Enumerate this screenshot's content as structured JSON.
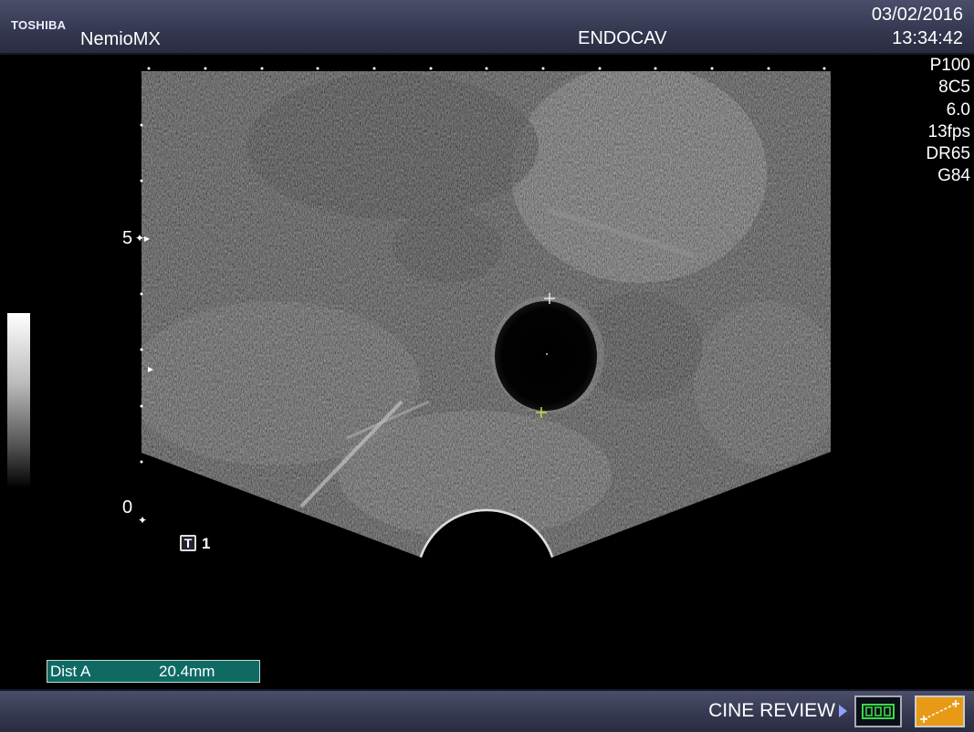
{
  "header": {
    "brand": "TOSHIBA",
    "model": "NemioMX",
    "probe": "ENDOCAV",
    "date": "03/02/2016",
    "time": "13:34:42"
  },
  "params": [
    "P100",
    "8C5",
    "6.0",
    "13fps",
    "DR65",
    "G84"
  ],
  "depth_scale": {
    "top_label": "5",
    "bottom_label": "0"
  },
  "trace_marker": {
    "letter": "T",
    "number": "1"
  },
  "measurement": {
    "label": "Dist A",
    "value": "20.4mm"
  },
  "footer": {
    "cine_label": "CINE REVIEW"
  },
  "colors": {
    "accent_orange": "#e89a16",
    "measure_box": "#0f6a64",
    "caliper_green": "#c8d44a"
  }
}
